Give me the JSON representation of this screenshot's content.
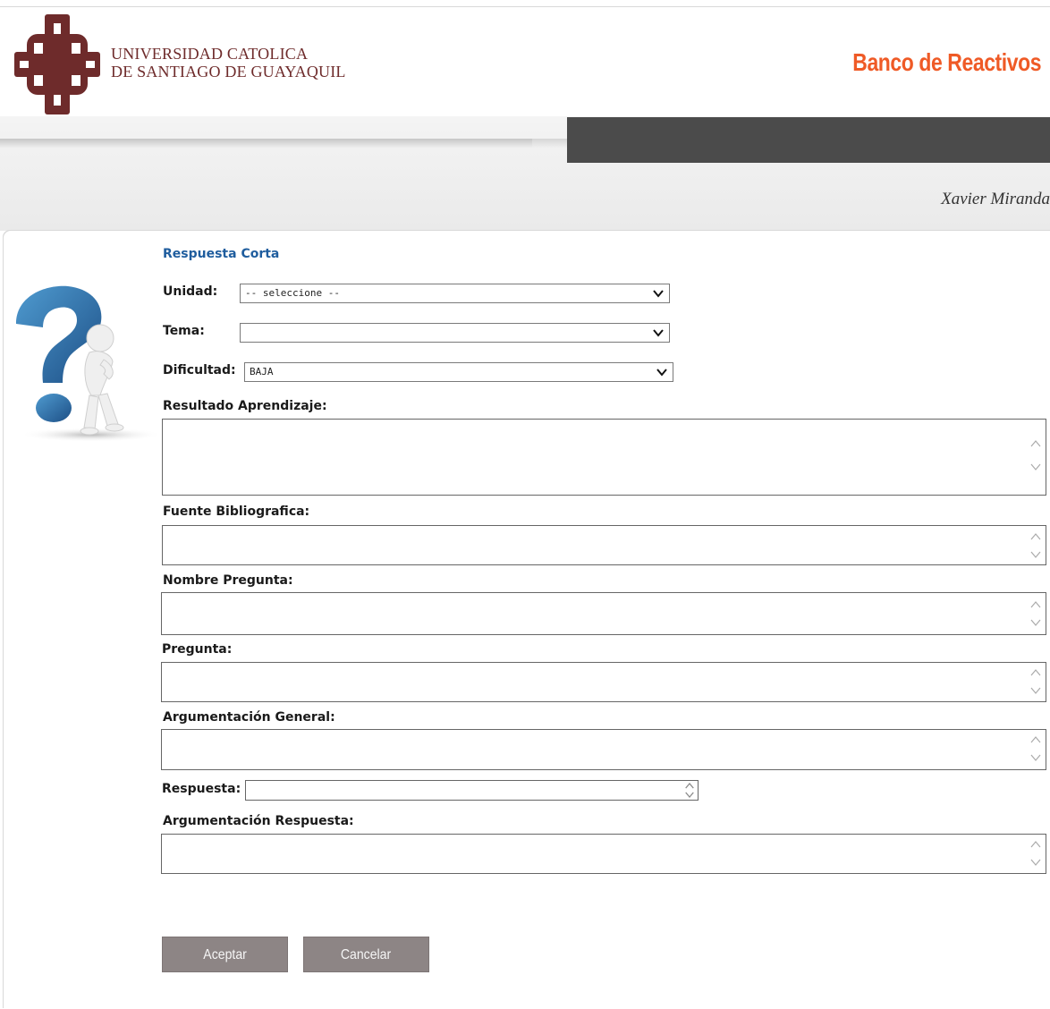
{
  "header": {
    "university_line1": "UNIVERSIDAD CATOLICA",
    "university_line2": "DE SANTIAGO DE GUAYAQUIL",
    "app_title": "Banco de Reactivos",
    "user_name": "Xavier Miranda",
    "colors": {
      "brand": "#6e2b2b",
      "app_title": "#ef5a26",
      "dark_band": "#4b4b4b"
    }
  },
  "form": {
    "title": "Respuesta Corta",
    "unidad": {
      "label": "Unidad:",
      "value": "-- seleccione --"
    },
    "tema": {
      "label": "Tema:",
      "value": ""
    },
    "dificultad": {
      "label": "Dificultad:",
      "value": "BAJA"
    },
    "resultado_aprendizaje": {
      "label": "Resultado Aprendizaje:",
      "value": ""
    },
    "fuente_bibliografica": {
      "label": "Fuente Bibliografica:",
      "value": ""
    },
    "nombre_pregunta": {
      "label": "Nombre Pregunta:",
      "value": ""
    },
    "pregunta": {
      "label": "Pregunta:",
      "value": ""
    },
    "argumentacion_general": {
      "label": "Argumentación General:",
      "value": ""
    },
    "respuesta": {
      "label": "Respuesta:",
      "value": ""
    },
    "argumentacion_respuesta": {
      "label": "Argumentación Respuesta:",
      "value": ""
    },
    "buttons": {
      "accept": "Aceptar",
      "cancel": "Cancelar"
    }
  },
  "icons": [
    "university-crest-icon",
    "question-mark-figure-icon",
    "chevron-down-icon",
    "scroll-up-icon",
    "scroll-down-icon"
  ]
}
